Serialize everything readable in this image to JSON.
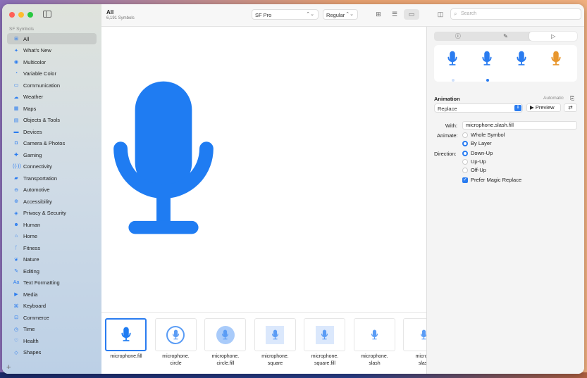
{
  "colors": {
    "accent": "#2a7cf0",
    "orange": "#e8962c"
  },
  "sidebar": {
    "header": "SF Symbols",
    "items": [
      {
        "label": "All",
        "icon": "grid-icon"
      },
      {
        "label": "What's New",
        "icon": "sparkle-icon"
      },
      {
        "label": "Multicolor",
        "icon": "paintpalette-icon"
      },
      {
        "label": "Variable Color",
        "icon": "variable-icon"
      },
      {
        "label": "Communication",
        "icon": "bubble-icon"
      },
      {
        "label": "Weather",
        "icon": "cloud-icon"
      },
      {
        "label": "Maps",
        "icon": "map-icon"
      },
      {
        "label": "Objects & Tools",
        "icon": "folder-icon"
      },
      {
        "label": "Devices",
        "icon": "desktop-icon"
      },
      {
        "label": "Camera & Photos",
        "icon": "camera-icon"
      },
      {
        "label": "Gaming",
        "icon": "gamecontroller-icon"
      },
      {
        "label": "Connectivity",
        "icon": "antenna-icon"
      },
      {
        "label": "Transportation",
        "icon": "car-icon"
      },
      {
        "label": "Automotive",
        "icon": "automotive-icon"
      },
      {
        "label": "Accessibility",
        "icon": "accessibility-icon"
      },
      {
        "label": "Privacy & Security",
        "icon": "lock-icon"
      },
      {
        "label": "Human",
        "icon": "person-icon"
      },
      {
        "label": "Home",
        "icon": "house-icon"
      },
      {
        "label": "Fitness",
        "icon": "figure-run-icon"
      },
      {
        "label": "Nature",
        "icon": "leaf-icon"
      },
      {
        "label": "Editing",
        "icon": "pencil-icon"
      },
      {
        "label": "Text Formatting",
        "icon": "textformat-icon"
      },
      {
        "label": "Media",
        "icon": "play-icon"
      },
      {
        "label": "Keyboard",
        "icon": "command-icon"
      },
      {
        "label": "Commerce",
        "icon": "cart-icon"
      },
      {
        "label": "Time",
        "icon": "clock-icon"
      },
      {
        "label": "Health",
        "icon": "heart-icon"
      },
      {
        "label": "Shapes",
        "icon": "shapes-icon"
      }
    ]
  },
  "toolbar": {
    "title": "All",
    "subtitle": "6,191 Symbols",
    "font": "SF Pro",
    "weight": "Regular",
    "search_placeholder": "Search"
  },
  "symbols": [
    {
      "l1": "microphone.fill",
      "l2": ""
    },
    {
      "l1": "microphone.",
      "l2": "circle"
    },
    {
      "l1": "microphone.",
      "l2": "circle.fill"
    },
    {
      "l1": "microphone.",
      "l2": "square"
    },
    {
      "l1": "microphone.",
      "l2": "square.fill"
    },
    {
      "l1": "microphone.",
      "l2": "slash"
    },
    {
      "l1": "microph",
      "l2": "slash"
    }
  ],
  "inspector": {
    "section": "Animation",
    "automatic": "Automatic",
    "effect": "Replace",
    "preview": "Preview",
    "with_label": "With:",
    "with_value": "microphone.slash.fill",
    "animate_label": "Animate:",
    "animate_options": [
      "Whole Symbol",
      "By Layer"
    ],
    "animate_selected": "By Layer",
    "direction_label": "Direction:",
    "direction_options": [
      "Down-Up",
      "Up-Up",
      "Off-Up"
    ],
    "direction_selected": "Down-Up",
    "prefer_magic": "Prefer Magic Replace",
    "prefer_magic_checked": true
  }
}
